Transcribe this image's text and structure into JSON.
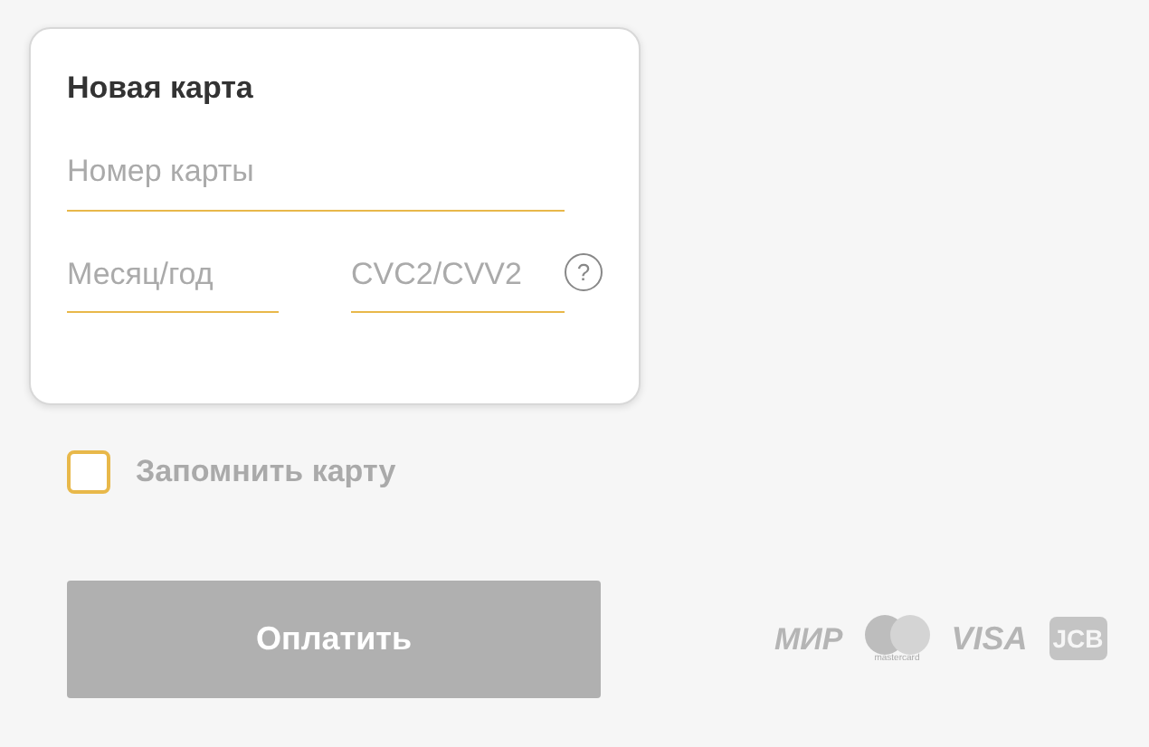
{
  "card_form": {
    "title": "Новая карта",
    "fields": [
      {
        "kind": "number",
        "placeholder": "Номер карты"
      },
      {
        "kind": "expiry",
        "placeholder": "Месяц/год"
      },
      {
        "kind": "cvc",
        "placeholder": "CVC2/CVV2",
        "help": "?"
      }
    ]
  },
  "remember": {
    "label": "Запомнить карту",
    "checked": false
  },
  "pay_button": {
    "label": "Оплатить",
    "disabled": true
  },
  "payment_logos": [
    {
      "kind": "mir",
      "text": "МИР"
    },
    {
      "kind": "mastercard",
      "text": "mastercard"
    },
    {
      "kind": "visa",
      "text": "VISA"
    },
    {
      "kind": "jcb",
      "text": "JCB"
    }
  ]
}
